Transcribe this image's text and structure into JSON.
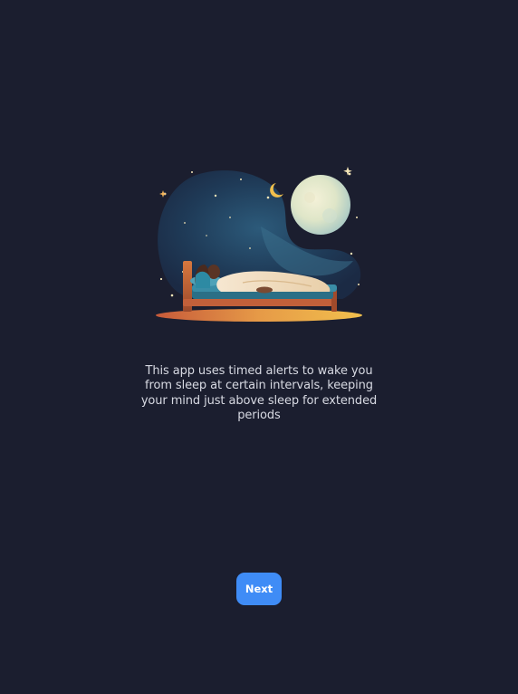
{
  "illustration": {
    "icon": "sleeping-person-under-moon-illustration"
  },
  "onboarding": {
    "description": "This app uses timed alerts to wake you from sleep at certain intervals, keeping your mind just above sleep for extended periods"
  },
  "actions": {
    "next_label": "Next"
  },
  "colors": {
    "background": "#1b1e2f",
    "accent": "#3f8cf6",
    "text": "#d7d9e2"
  }
}
